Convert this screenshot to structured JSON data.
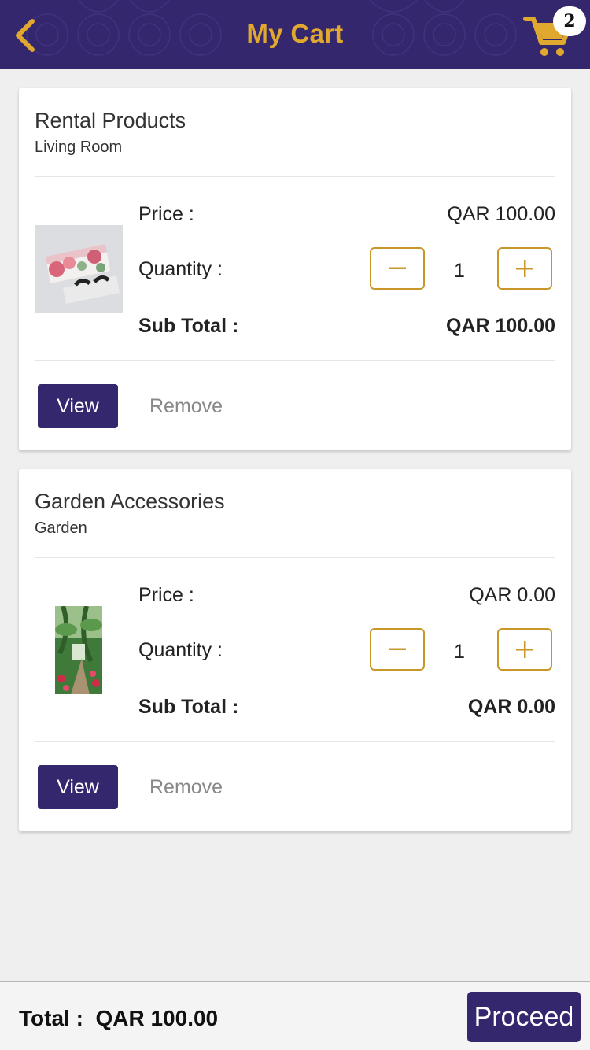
{
  "header": {
    "title": "My Cart",
    "back_icon": "chevron-left-icon",
    "cart_icon": "shopping-cart-icon",
    "cart_count": "2",
    "bg_color": "#34276e",
    "accent_color": "#e0a82e"
  },
  "labels": {
    "price": "Price :",
    "quantity": "Quantity :",
    "subtotal": "Sub Total :",
    "view": "View",
    "remove": "Remove",
    "minus_icon": "minus-icon",
    "plus_icon": "plus-icon"
  },
  "items": [
    {
      "title": "Rental Products",
      "subtitle": "Living Room",
      "price": "QAR 100.00",
      "quantity": "1",
      "subtotal": "QAR 100.00",
      "image": "eyelashes-product-image"
    },
    {
      "title": "Garden Accessories",
      "subtitle": "Garden",
      "price": "QAR 0.00",
      "quantity": "1",
      "subtotal": "QAR 0.00",
      "image": "garden-product-image"
    }
  ],
  "footer": {
    "total_label": "Total :",
    "total_value": "QAR 100.00",
    "proceed_label": "Proceed"
  }
}
